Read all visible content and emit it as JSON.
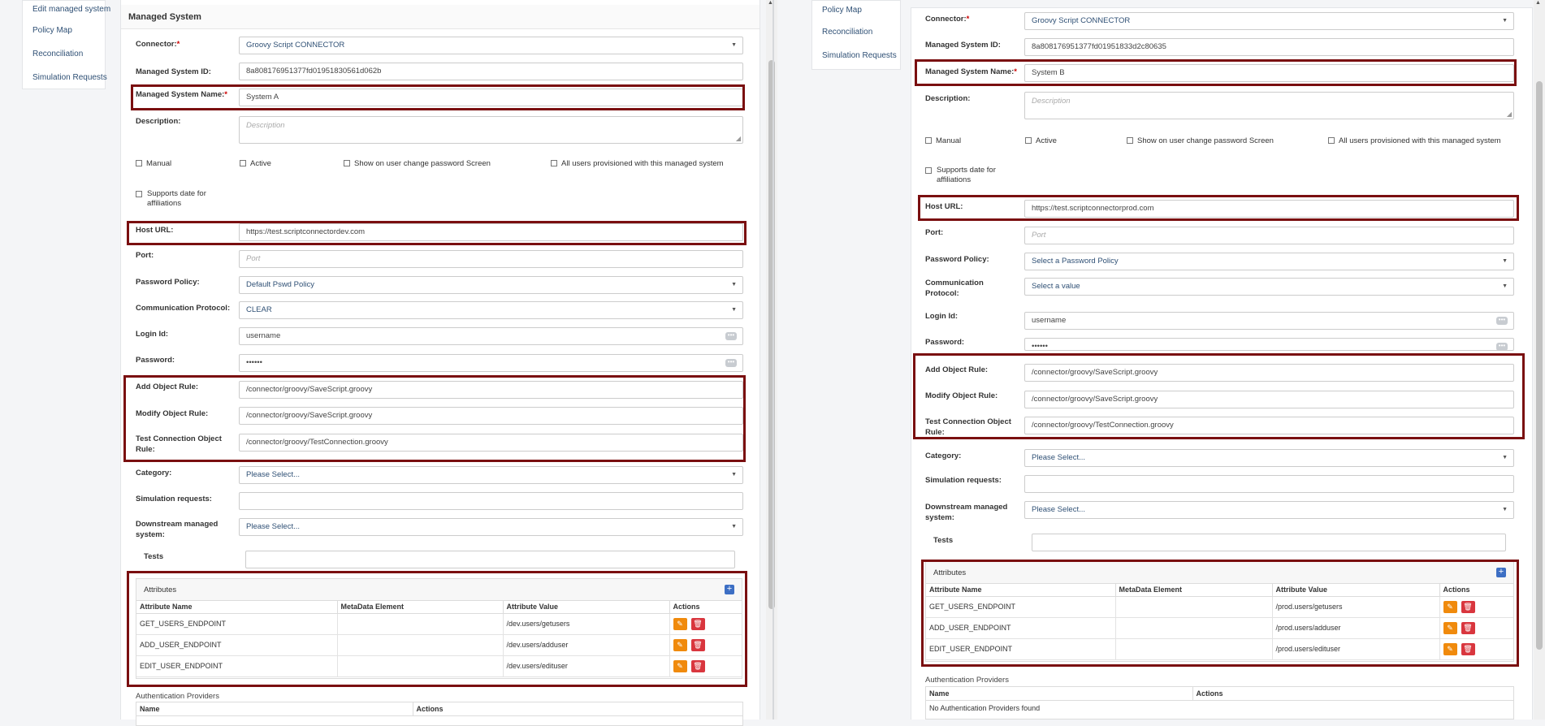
{
  "left": {
    "nav": [
      "Edit managed system",
      "Policy Map",
      "Reconciliation",
      "Simulation Requests"
    ],
    "panel_title": "Managed System",
    "connector": {
      "label": "Connector:",
      "value": "Groovy Script CONNECTOR"
    },
    "ms_id": {
      "label": "Managed System ID:",
      "value": "8a808176951377fd01951830561d062b"
    },
    "ms_name": {
      "label": "Managed System Name:",
      "value": "System A"
    },
    "description": {
      "label": "Description:",
      "placeholder": "Description"
    },
    "checks": [
      "Manual",
      "Active",
      "Show on user change password Screen",
      "All users provisioned with this managed system"
    ],
    "supports_date": "Supports date for affiliations",
    "host_url": {
      "label": "Host URL:",
      "value": "https://test.scriptconnectordev.com"
    },
    "port": {
      "label": "Port:",
      "placeholder": "Port"
    },
    "password_policy": {
      "label": "Password Policy:",
      "value": "Default Pswd Policy"
    },
    "comm_protocol": {
      "label": "Communication Protocol:",
      "value": "CLEAR"
    },
    "login_id": {
      "label": "Login Id:",
      "value": "username"
    },
    "password": {
      "label": "Password:",
      "value": "••••••"
    },
    "add_rule": {
      "label": "Add Object Rule:",
      "value": "/connector/groovy/SaveScript.groovy"
    },
    "modify_rule": {
      "label": "Modify Object Rule:",
      "value": "/connector/groovy/SaveScript.groovy"
    },
    "test_rule": {
      "label": "Test Connection Object Rule:",
      "value": "/connector/groovy/TestConnection.groovy"
    },
    "category": {
      "label": "Category:",
      "value": "Please Select..."
    },
    "simulation": {
      "label": "Simulation requests:"
    },
    "downstream": {
      "label": "Downstream managed system:",
      "value": "Please Select..."
    },
    "tests": {
      "label": "Tests"
    },
    "attributes": {
      "title": "Attributes",
      "columns": [
        "Attribute Name",
        "MetaData Element",
        "Attribute Value",
        "Actions"
      ],
      "rows": [
        {
          "name": "GET_USERS_ENDPOINT",
          "meta": "",
          "value": "/dev.users/getusers"
        },
        {
          "name": "ADD_USER_ENDPOINT",
          "meta": "",
          "value": "/dev.users/adduser"
        },
        {
          "name": "EDIT_USER_ENDPOINT",
          "meta": "",
          "value": "/dev.users/edituser"
        }
      ]
    },
    "auth": {
      "title": "Authentication Providers",
      "columns": [
        "Name",
        "Actions"
      ]
    }
  },
  "right": {
    "nav": [
      "Policy Map",
      "Reconciliation",
      "Simulation Requests"
    ],
    "connector": {
      "label": "Connector:",
      "value": "Groovy Script CONNECTOR"
    },
    "ms_id": {
      "label": "Managed System ID:",
      "value": "8a808176951377fd01951833d2c80635"
    },
    "ms_name": {
      "label": "Managed System Name:",
      "value": "System B"
    },
    "description": {
      "label": "Description:",
      "placeholder": "Description"
    },
    "checks": [
      "Manual",
      "Active",
      "Show on user change password Screen",
      "All users provisioned with this managed system"
    ],
    "supports_date": "Supports date for affiliations",
    "host_url": {
      "label": "Host URL:",
      "value": "https://test.scriptconnectorprod.com"
    },
    "port": {
      "label": "Port:",
      "placeholder": "Port"
    },
    "password_policy": {
      "label": "Password Policy:",
      "value": "Select a Password Policy"
    },
    "comm_protocol": {
      "label": "Communication Protocol:",
      "value": "Select a value"
    },
    "login_id": {
      "label": "Login Id:",
      "value": "username"
    },
    "password": {
      "label": "Password:",
      "value": "••••••"
    },
    "add_rule": {
      "label": "Add Object Rule:",
      "value": "/connector/groovy/SaveScript.groovy"
    },
    "modify_rule": {
      "label": "Modify Object Rule:",
      "value": "/connector/groovy/SaveScript.groovy"
    },
    "test_rule": {
      "label": "Test Connection Object Rule:",
      "value": "/connector/groovy/TestConnection.groovy"
    },
    "category": {
      "label": "Category:",
      "value": "Please Select..."
    },
    "simulation": {
      "label": "Simulation requests:"
    },
    "downstream": {
      "label": "Downstream managed system:",
      "value": "Please Select..."
    },
    "tests": {
      "label": "Tests"
    },
    "attributes": {
      "title": "Attributes",
      "columns": [
        "Attribute Name",
        "MetaData Element",
        "Attribute Value",
        "Actions"
      ],
      "rows": [
        {
          "name": "GET_USERS_ENDPOINT",
          "meta": "",
          "value": "/prod.users/getusers"
        },
        {
          "name": "ADD_USER_ENDPOINT",
          "meta": "",
          "value": "/prod.users/adduser"
        },
        {
          "name": "EDIT_USER_ENDPOINT",
          "meta": "",
          "value": "/prod.users/edituser"
        }
      ]
    },
    "auth": {
      "title": "Authentication Providers",
      "columns": [
        "Name",
        "Actions"
      ],
      "empty": "No Authentication Providers found"
    }
  },
  "colors": {
    "highlight": "#7a0f10",
    "edit": "#f08a0c",
    "delete": "#d9363e",
    "add": "#3d6fc4",
    "link": "#2f5075"
  },
  "icons": {
    "add": "plus-icon",
    "edit": "pencil-icon",
    "delete": "trash-icon",
    "dropdown": "caret-down-icon",
    "password": "more-icon"
  }
}
